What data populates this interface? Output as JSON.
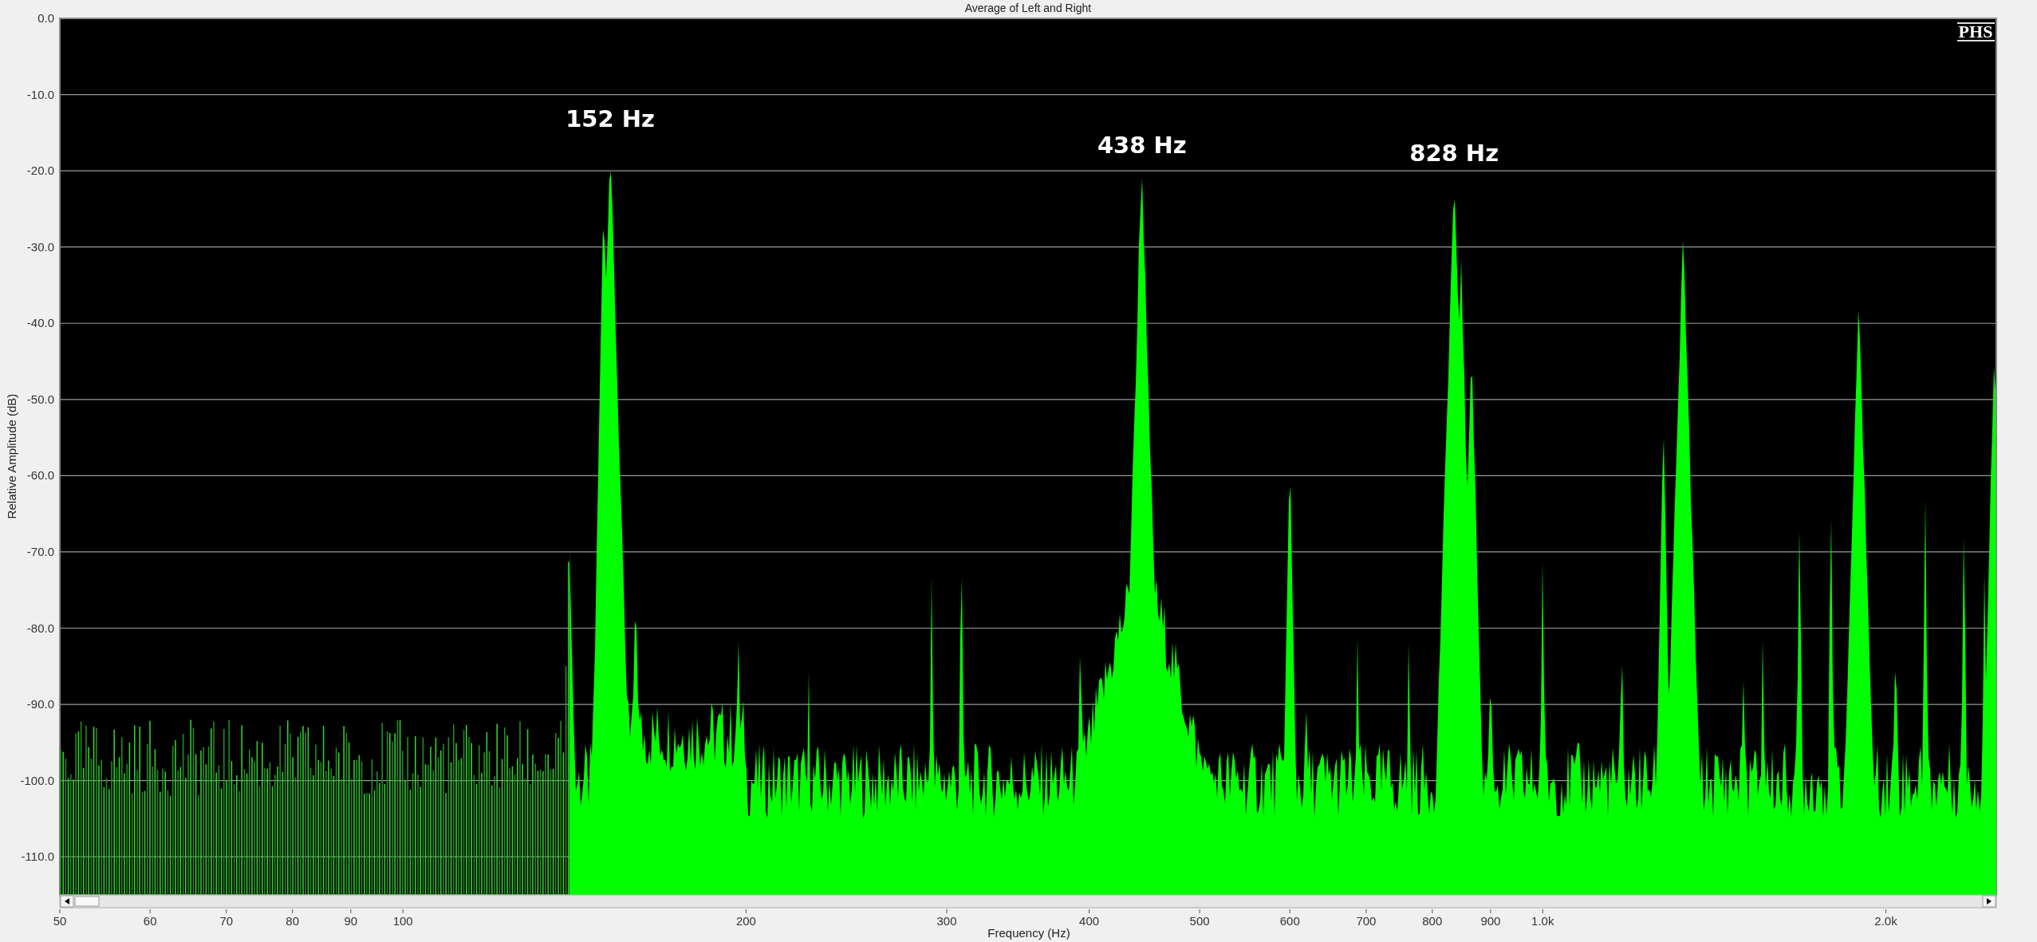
{
  "chart": {
    "title": "Average of Left and Right",
    "logo": "PHS",
    "peak_labels": [
      "152 Hz",
      "438 Hz",
      "828 Hz"
    ],
    "y_axis": {
      "label": "Relative Amplitude (dB)",
      "ticks": [
        "0.0",
        "-10.0",
        "-20.0",
        "-30.0",
        "-40.0",
        "-50.0",
        "-60.0",
        "-70.0",
        "-80.0",
        "-90.0",
        "-100.0",
        "-110.0"
      ]
    },
    "x_axis": {
      "label": "Frequency (Hz)",
      "ticks": [
        "50",
        "60",
        "70",
        "80",
        "90",
        "100",
        "200",
        "300",
        "400",
        "500",
        "600",
        "700",
        "800",
        "900",
        "1.0k",
        "2.0k"
      ]
    }
  }
}
